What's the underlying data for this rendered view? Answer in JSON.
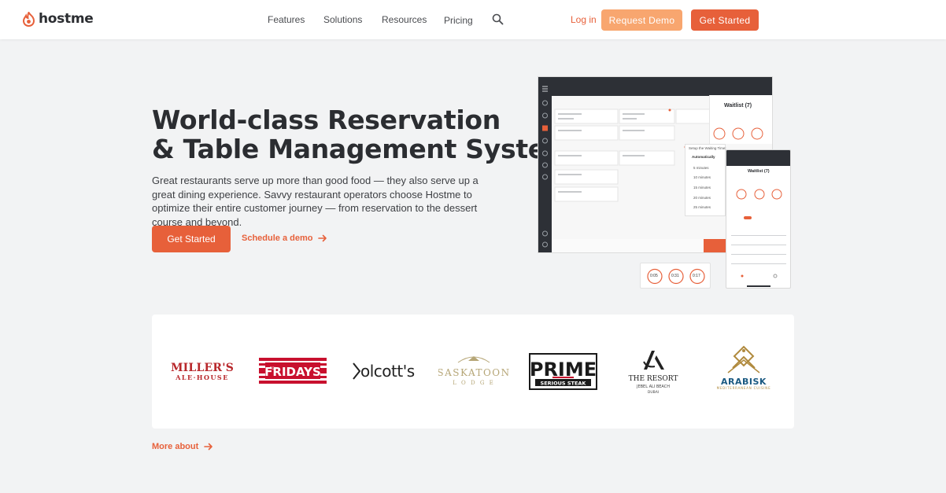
{
  "brand": {
    "name": "hostme",
    "accent": "#e7603a",
    "accent_light": "#f8a66f"
  },
  "nav": {
    "items": [
      {
        "label": "Features"
      },
      {
        "label": "Solutions"
      },
      {
        "label": "Resources"
      },
      {
        "label": "Pricing"
      }
    ],
    "search_icon": "search-icon",
    "login_label": "Log in",
    "demo_label": "Request Demo",
    "start_label": "Get Started"
  },
  "hero": {
    "title_line1": "World-class Reservation",
    "title_line2": "& Table Management System",
    "description": "Great restaurants serve up more than good food — they also serve up a great dining experience. Savvy restaurant operators choose Hostme to optimize their entire customer journey — from reservation to the dessert course and beyond.",
    "cta_label": "Get Started",
    "schedule_label": "Schedule a demo"
  },
  "mockup": {
    "waitlist_title": "Waitlist (7)",
    "phone_title": "Waitlist (7)",
    "popup_title": "Setup the Waiting Time:",
    "popup_options": [
      "Automatically",
      "5 minutes",
      "10 minutes",
      "15 minutes",
      "20 minutes",
      "25 minutes",
      "30 minutes"
    ],
    "timers": [
      "0:05",
      "0:31",
      "0:17"
    ]
  },
  "clients": [
    {
      "name": "MILLER'S ALE·HOUSE"
    },
    {
      "name": "TGI FRIDAYS"
    },
    {
      "name": "olcott's"
    },
    {
      "name": "SASKATOON LODGE"
    },
    {
      "name": "PRIME SERIOUS STEAK"
    },
    {
      "name": "THE RESORT JEBEL ALI BEACH DUBAI"
    },
    {
      "name": "ARABISK MEDITERRANEAN CUISINE"
    }
  ],
  "more_label": "More about"
}
